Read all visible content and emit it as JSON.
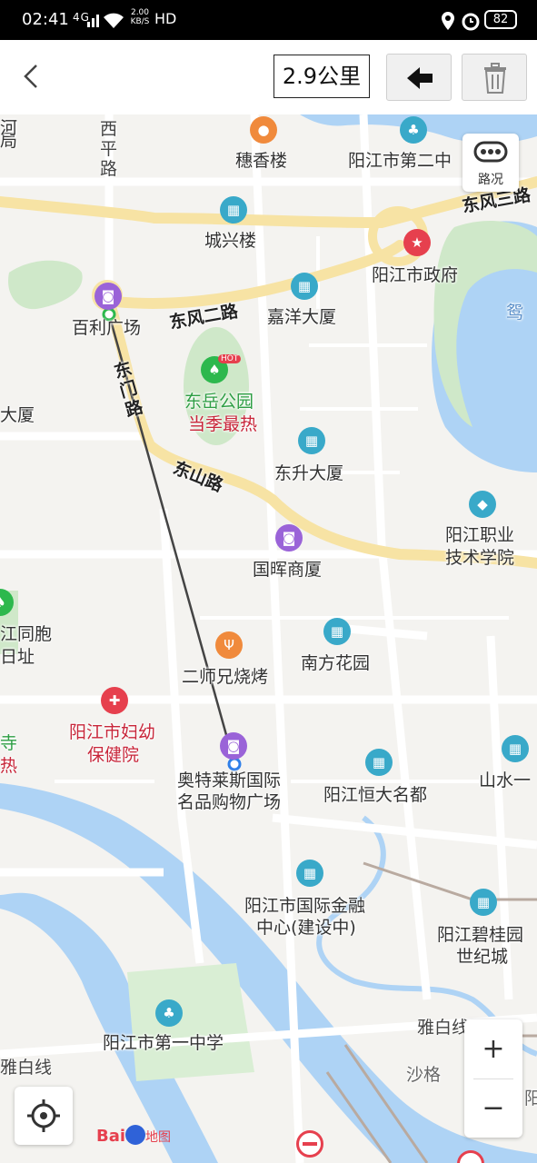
{
  "status_bar": {
    "time": "02:41",
    "network": "4G",
    "speed_value": "2.00",
    "speed_unit": "KB/S",
    "hd": "HD",
    "battery": "82"
  },
  "toolbar": {
    "distance": "2.9公里"
  },
  "traffic_button": {
    "label": "路况"
  },
  "zoom": {
    "plus": "+",
    "minus": "−"
  },
  "logo": {
    "text": "地图"
  },
  "roads": {
    "xiping": "西\n平\n路",
    "dongfeng_er": "东风二路",
    "dongfeng_er_right": "东风三路",
    "dongmen": "东\n门\n路",
    "dongshan": "东山路",
    "yabaixian": "雅白线",
    "yabaixian_left": "雅白线"
  },
  "places": {
    "suixianglou": "穗香楼",
    "yangjiang_er_zhong": "阳江市第二中",
    "chengxinglou": "城兴楼",
    "zhengfu": "阳江市政府",
    "baili": "百利广场",
    "jiayang": "嘉洋大厦",
    "dongyue_park": "东岳公园",
    "dongyue_hot": "当季最热",
    "hot_badge": "HOT",
    "dasha_left": "大厦",
    "dongsheng": "东升大厦",
    "zhiye_1": "阳江职业",
    "zhiye_2": "技术学院",
    "guohui": "国晖商厦",
    "tongbao_1": "江同胞",
    "tongbao_2": "日址",
    "nanfang": "南方花园",
    "ershixiong": "二师兄烧烤",
    "fuyou_1": "阳江市妇幼",
    "fuyou_2": "保健院",
    "si": "寺",
    "re": "热",
    "aotelaisi_1": "奥特莱斯国际",
    "aotelaisi_2": "名品购物广场",
    "hengda": "阳江恒大名都",
    "shanshui": "山水一",
    "jinrong_1": "阳江市国际金融",
    "jinrong_2": "中心(建设中)",
    "biguiyuan_1": "阳江碧桂园",
    "biguiyuan_2": "世纪城",
    "yizhong": "阳江市第一中学",
    "shage": "沙格",
    "yuan": "鸳",
    "ju": "局",
    "he": "河",
    "yang": "阳"
  },
  "colors": {
    "main_road": "#f7e3a4",
    "water": "#aed3f5",
    "park": "#cfe8c9",
    "route": "#444444",
    "start": "#2db84d",
    "end": "#2f7fe8",
    "poi_teal": "#39a9c9",
    "poi_purple": "#9a63d8",
    "poi_red": "#e6404e",
    "poi_orange": "#f08a3c"
  },
  "icons": [
    "back-arrow-icon",
    "left-arrow-icon",
    "trash-icon",
    "traffic-icon",
    "locate-icon",
    "zoom-in-icon",
    "zoom-out-icon"
  ]
}
